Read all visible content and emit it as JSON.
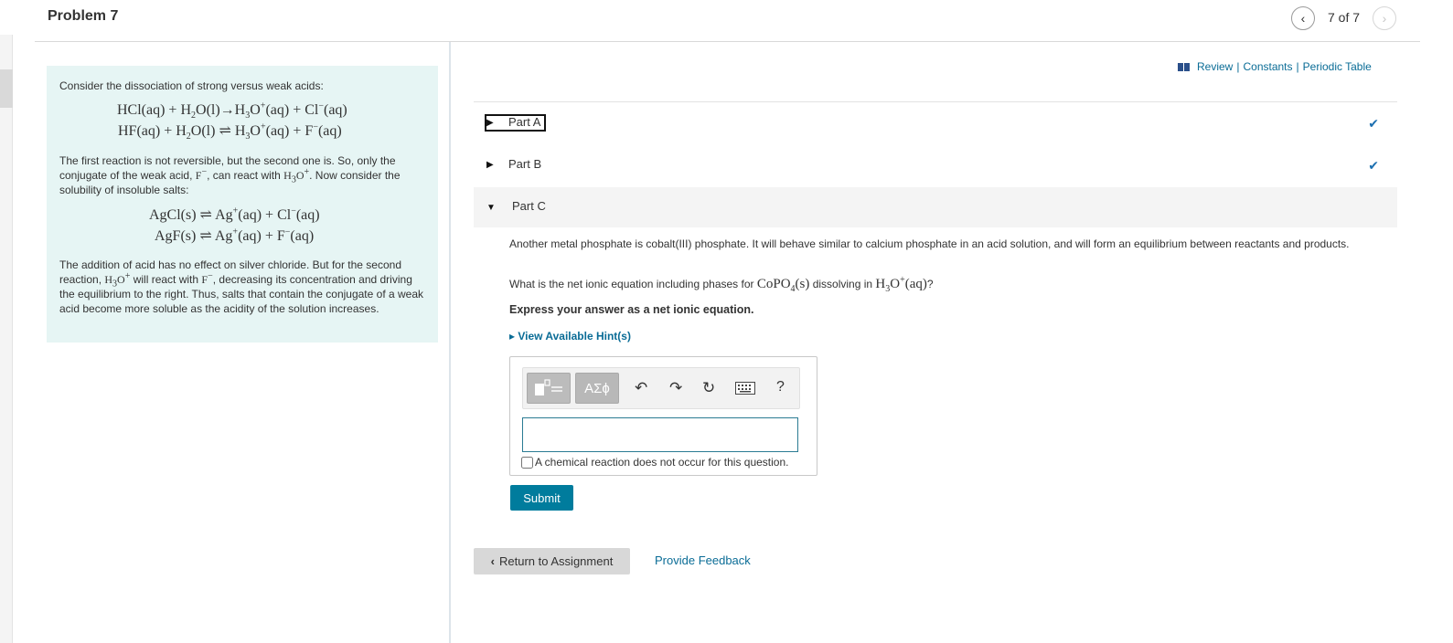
{
  "header": {
    "title": "Problem 7",
    "pager": "7 of 7",
    "prev_icon": "‹",
    "next_icon": "›"
  },
  "intro": {
    "p1": "Consider the dissociation of strong versus weak acids:",
    "p2a": "The first reaction is not reversible, but the second one is. So, only the conjugate of the weak acid,",
    "p2b": ", can react with",
    "p2c": ". Now consider the solubility of insoluble salts:",
    "p3a": "The addition of acid has no effect on silver chloride. But for the second reaction,",
    "p3b": "will react with",
    "p3c": ", decreasing its concentration and driving the equilibrium to the right. Thus, salts that contain the conjugate of a weak acid become more soluble as the acidity of the solution increases."
  },
  "links": {
    "review": "Review",
    "constants": "Constants",
    "periodic": "Periodic Table",
    "separator": "|"
  },
  "parts": [
    {
      "label": "Part A",
      "status": "✔"
    },
    {
      "label": "Part B",
      "status": "✔"
    },
    {
      "label": "Part C"
    }
  ],
  "part_c": {
    "text1": "Another metal phosphate is cobalt(III) phosphate. It will behave similar to calcium phosphate in an acid solution, and will form an equilibrium between reactants and products.",
    "q_a": "What is the net ionic equation including phases for",
    "q_b": "dissolving in",
    "q_c": "?",
    "instruction": "Express your answer as a net ionic equation.",
    "hint": "View Available Hint(s)",
    "greek_label": "ΑΣϕ",
    "help_label": "?",
    "no_reaction": "A chemical reaction does not occur for this question."
  },
  "buttons": {
    "submit": "Submit",
    "return": "Return to Assignment",
    "feedback": "Provide Feedback"
  },
  "colors": {
    "link": "#0a6c96",
    "submit_bg": "#007c9d",
    "intro_bg": "#e6f5f4",
    "check": "#1c6fb0"
  }
}
